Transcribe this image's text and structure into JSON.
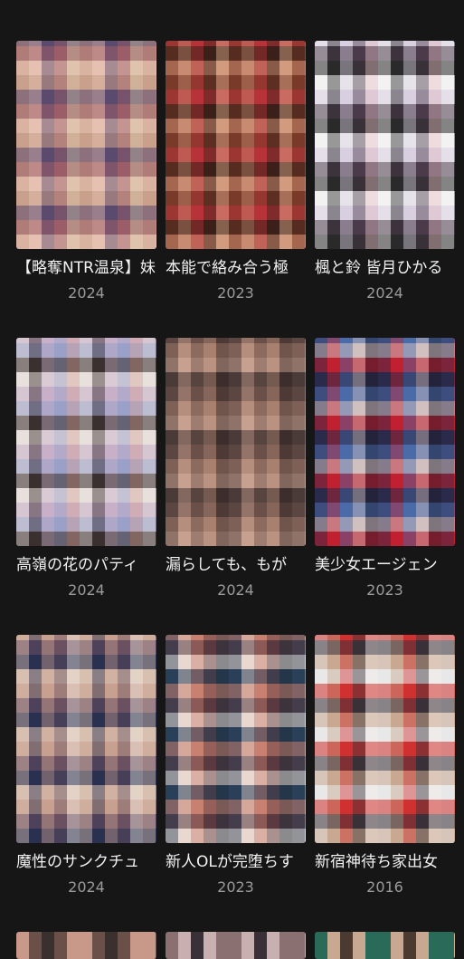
{
  "items": [
    {
      "title": "【略奪NTR温泉】妹",
      "year": "2024",
      "colors": [
        "#c9a08c",
        "#e6c0b0",
        "#5a4a6e",
        "#9b5e68",
        "#d8c6a8"
      ]
    },
    {
      "title": "本能で絡み合う極",
      "year": "2023",
      "colors": [
        "#7a3a2a",
        "#c88a70",
        "#b8323a",
        "#3a2018",
        "#e0b090"
      ]
    },
    {
      "title": "楓と鈴 皆月ひかる",
      "year": "2024",
      "colors": [
        "#f2f2f2",
        "#2a2a2a",
        "#d8d0e0",
        "#4a3a4a",
        "#e8c0c8"
      ]
    },
    {
      "title": "高嶺の花のパティ",
      "year": "2024",
      "colors": [
        "#e8e0dc",
        "#3a3030",
        "#c8b0c8",
        "#9aa0c8",
        "#d8a8a0"
      ]
    },
    {
      "title": "漏らしても、もが",
      "year": "2024",
      "colors": [
        "#4a3a38",
        "#c8a090",
        "#6a5048",
        "#a88070",
        "#2a2020"
      ]
    },
    {
      "title": "美少女エージェン",
      "year": "2023",
      "colors": [
        "#2a2a4a",
        "#c02030",
        "#4a6aa8",
        "#d0c0c0",
        "#1a1a2a"
      ]
    },
    {
      "title": "魔性のサンクチュ",
      "year": "2024",
      "colors": [
        "#d8c0b0",
        "#2a3050",
        "#c8a090",
        "#6a5060",
        "#f0e8e0"
      ]
    },
    {
      "title": "新人OLが完堕ちす",
      "year": "2023",
      "colors": [
        "#2a4058",
        "#e8d8d0",
        "#c88070",
        "#5a3a40",
        "#1a2a38"
      ]
    },
    {
      "title": "新宿神待ち家出女",
      "year": "2016",
      "colors": [
        "#e8e8e8",
        "#c8a890",
        "#d03030",
        "#3a3038",
        "#f4f0ec"
      ]
    }
  ],
  "partial_items": [
    {
      "colors": [
        "#c89888",
        "#6a5048",
        "#3a3030"
      ]
    },
    {
      "colors": [
        "#8a7070",
        "#c8b0b0",
        "#3a3038"
      ]
    },
    {
      "colors": [
        "#2a6a58",
        "#c8a890",
        "#4a3a30"
      ]
    }
  ]
}
